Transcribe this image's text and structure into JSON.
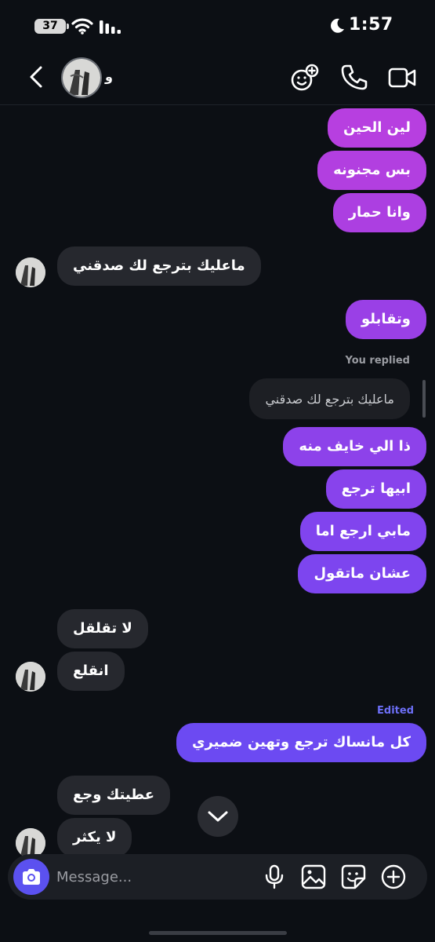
{
  "status_bar": {
    "battery": "37",
    "time": "1:57"
  },
  "header": {
    "contact_name": "⁧و⁩"
  },
  "messages": [
    {
      "text": "لين الحين",
      "direction": "out",
      "color": "#b73fe0"
    },
    {
      "text": "بس مجنونه",
      "direction": "out",
      "color": "#b23fe0"
    },
    {
      "text": "وانا حمار",
      "direction": "out",
      "color": "#ac3fe1"
    },
    {
      "text": "ماعليك بترجع لك صدقني",
      "direction": "in"
    },
    {
      "text": "وتقابلو",
      "direction": "out",
      "color": "#9a40e6"
    },
    {
      "text": "ذا الي خايف منه",
      "direction": "out",
      "color": "#8d42ea"
    },
    {
      "text": "ابيها ترجع",
      "direction": "out",
      "color": "#8843ec"
    },
    {
      "text": "مابي ارجع اما",
      "direction": "out",
      "color": "#8144ee"
    },
    {
      "text": "عشان ماتقول",
      "direction": "out",
      "color": "#7d45ef"
    },
    {
      "text": "لا تقلقل",
      "direction": "in"
    },
    {
      "text": "انقلع",
      "direction": "in"
    },
    {
      "text": "كل مانساك ترجع وتهين ضميري",
      "direction": "out",
      "color": "#6c4af2"
    },
    {
      "text": "عطيتك وجع",
      "direction": "in"
    },
    {
      "text": "لا يكثر",
      "direction": "in"
    }
  ],
  "reply": {
    "label": "You replied",
    "quoted_text": "ماعليك بترجع لك صدقني"
  },
  "edited_label": "Edited",
  "composer": {
    "placeholder": "Message..."
  }
}
